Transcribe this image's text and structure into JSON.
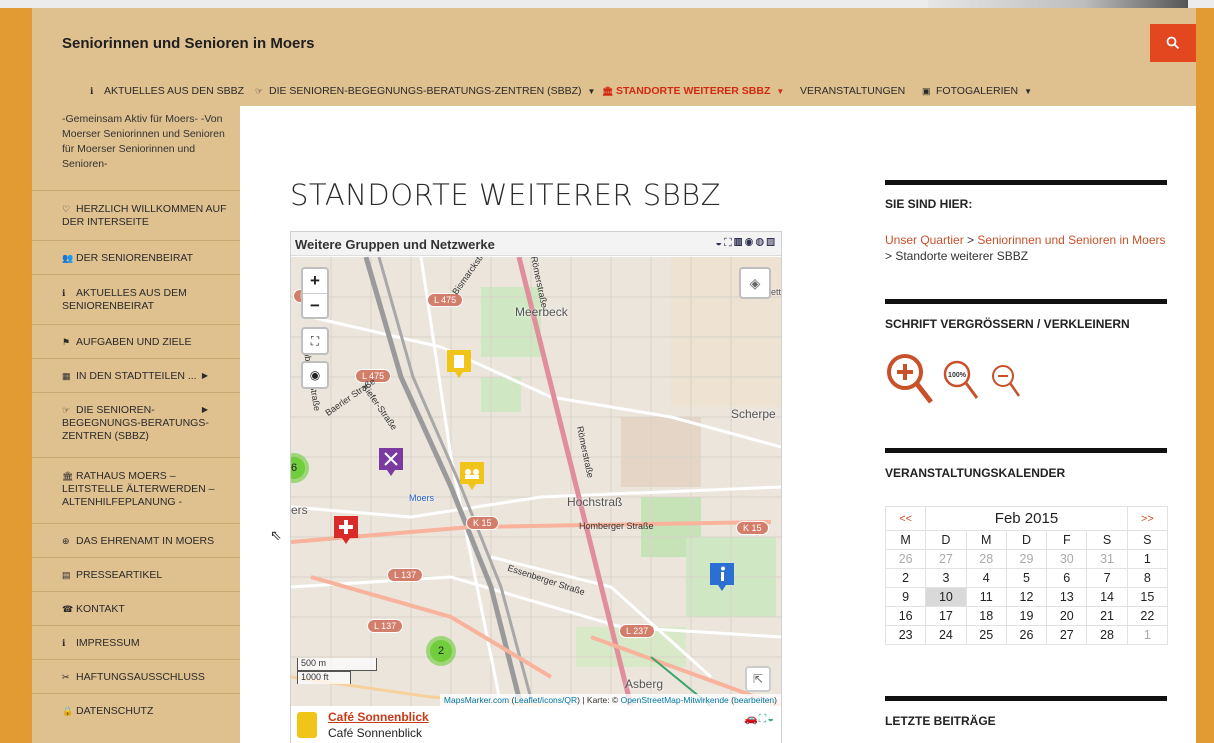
{
  "site": {
    "title": "Seniorinnen und Senioren in Moers"
  },
  "nav": {
    "items": [
      {
        "icon": "info-icon",
        "label": "AKTUELLES AUS DEN SBBZ"
      },
      {
        "icon": "hand-point-icon",
        "label": "DIE SENIOREN-BEGEGNUNGS-BERATUNGS-ZENTREN (SBBZ)"
      },
      {
        "icon": "bank-icon",
        "label": "STANDORTE WEITERER SBBZ",
        "active": true
      },
      {
        "label": "VERANSTALTUNGEN"
      },
      {
        "icon": "image-icon",
        "label": "FOTOGALERIEN"
      }
    ]
  },
  "sidebar": {
    "tagline": "-Gemeinsam Aktiv für Moers- -Von Moerser Seniorinnen und Senioren für Moerser Seniorinnen und Senioren-",
    "items": [
      {
        "icon": "heart-icon",
        "label": "HERZLICH WILLKOMMEN AUF DER INTERSEITE"
      },
      {
        "icon": "group-icon",
        "label": "DER SENIORENBEIRAT"
      },
      {
        "icon": "info-icon",
        "label": "AKTUELLES AUS DEM SENIORENBEIRAT"
      },
      {
        "icon": "flag-icon",
        "label": "AUFGABEN UND ZIELE"
      },
      {
        "icon": "table-icon",
        "label": "IN DEN STADTTEILEN ..."
      },
      {
        "icon": "hand-point-icon",
        "label": "DIE SENIOREN-BEGEGNUNGS-BERATUNGS-ZENTREN (SBBZ)"
      },
      {
        "icon": "bank-icon",
        "label": "RATHAUS MOERS – LEITSTELLE ÄLTERWERDEN – ALTENHILFEPLANUNG -"
      },
      {
        "icon": "lifebuoy-icon",
        "label": "DAS EHRENAMT IN MOERS"
      },
      {
        "icon": "newspaper-icon",
        "label": "PRESSEARTIKEL"
      },
      {
        "icon": "phone-icon",
        "label": "KONTAKT"
      },
      {
        "icon": "info-icon",
        "label": "IMPRESSUM"
      },
      {
        "icon": "scissors-icon",
        "label": "HAFTUNGSAUSSCHLUSS"
      },
      {
        "icon": "lock-icon",
        "label": "DATENSCHUTZ"
      }
    ]
  },
  "page": {
    "title": "STANDORTE WEITERER SBBZ"
  },
  "map": {
    "title": "Weitere Gruppen und Netzwerke",
    "zoom_in": "+",
    "zoom_out": "−",
    "labels": {
      "meerbeck": "Meerbeck",
      "scherpe": "Scherpe",
      "hochstrass": "Hochstraß",
      "asberg": "Asberg",
      "moers": "Moers",
      "ers": "ers",
      "ett": "ett"
    },
    "roads": {
      "l475a": "L 475",
      "l475b": "L 475",
      "k15a": "K 15",
      "k15b": "K 15",
      "l137a": "L 137",
      "l137b": "L 137",
      "l237": "L 237",
      "l13": "L 13"
    },
    "streets": {
      "roemerstrasse": "Römerstraße",
      "bismarckstrasse": "Bismarckstraße",
      "baerler": "Baerler Straße",
      "kiefer": "Kiefer-Straße",
      "rheinberger": "Rheinberger Straße",
      "homberger": "Homberger Straße",
      "essenberger": "Essenberger Straße",
      "roemerstrasse2": "Römerstraße"
    },
    "clusters": {
      "c1": "6",
      "c2": "2"
    },
    "scale": {
      "metric": "500 m",
      "imperial": "1000 ft"
    },
    "attribution": {
      "maker": "MapsMarker.com",
      "leaflet": "Leaflet/icons/QR",
      "karte": "| Karte: ©",
      "osm": "OpenStreetMap-Mitwirkende",
      "edit": "bearbeiten"
    },
    "footer": {
      "link": "Café Sonnenblick",
      "sub": "Café Sonnenblick"
    }
  },
  "widgets": {
    "breadcrumb_title": "SIE SIND HIER:",
    "breadcrumb": {
      "a": "Unser Quartier",
      "sep1": " > ",
      "b": "Seniorinnen und Senioren in Moers",
      "sep2": " > ",
      "current": "Standorte weiterer SBBZ"
    },
    "fontsize_title": "SCHRIFT VERGRÖSSERN / VERKLEINERN",
    "fontsize_reset": "100%",
    "calendar_title": "VERANSTALTUNGSKALENDER",
    "recent_title": "LETZTE BEITRÄGE"
  },
  "calendar": {
    "prev": "<<",
    "next": ">>",
    "month": "Feb 2015",
    "weekdays": [
      "M",
      "D",
      "M",
      "D",
      "F",
      "S",
      "S"
    ],
    "weeks": [
      [
        "26",
        "27",
        "28",
        "29",
        "30",
        "31",
        "1"
      ],
      [
        "2",
        "3",
        "4",
        "5",
        "6",
        "7",
        "8"
      ],
      [
        "9",
        "10",
        "11",
        "12",
        "13",
        "14",
        "15"
      ],
      [
        "16",
        "17",
        "18",
        "19",
        "20",
        "21",
        "22"
      ],
      [
        "23",
        "24",
        "25",
        "26",
        "27",
        "28",
        "1"
      ]
    ],
    "today": "10"
  },
  "colors": {
    "accent": "#c8512a",
    "header": "#dfc08f",
    "frame": "#e29b32",
    "search": "#e2471f"
  }
}
